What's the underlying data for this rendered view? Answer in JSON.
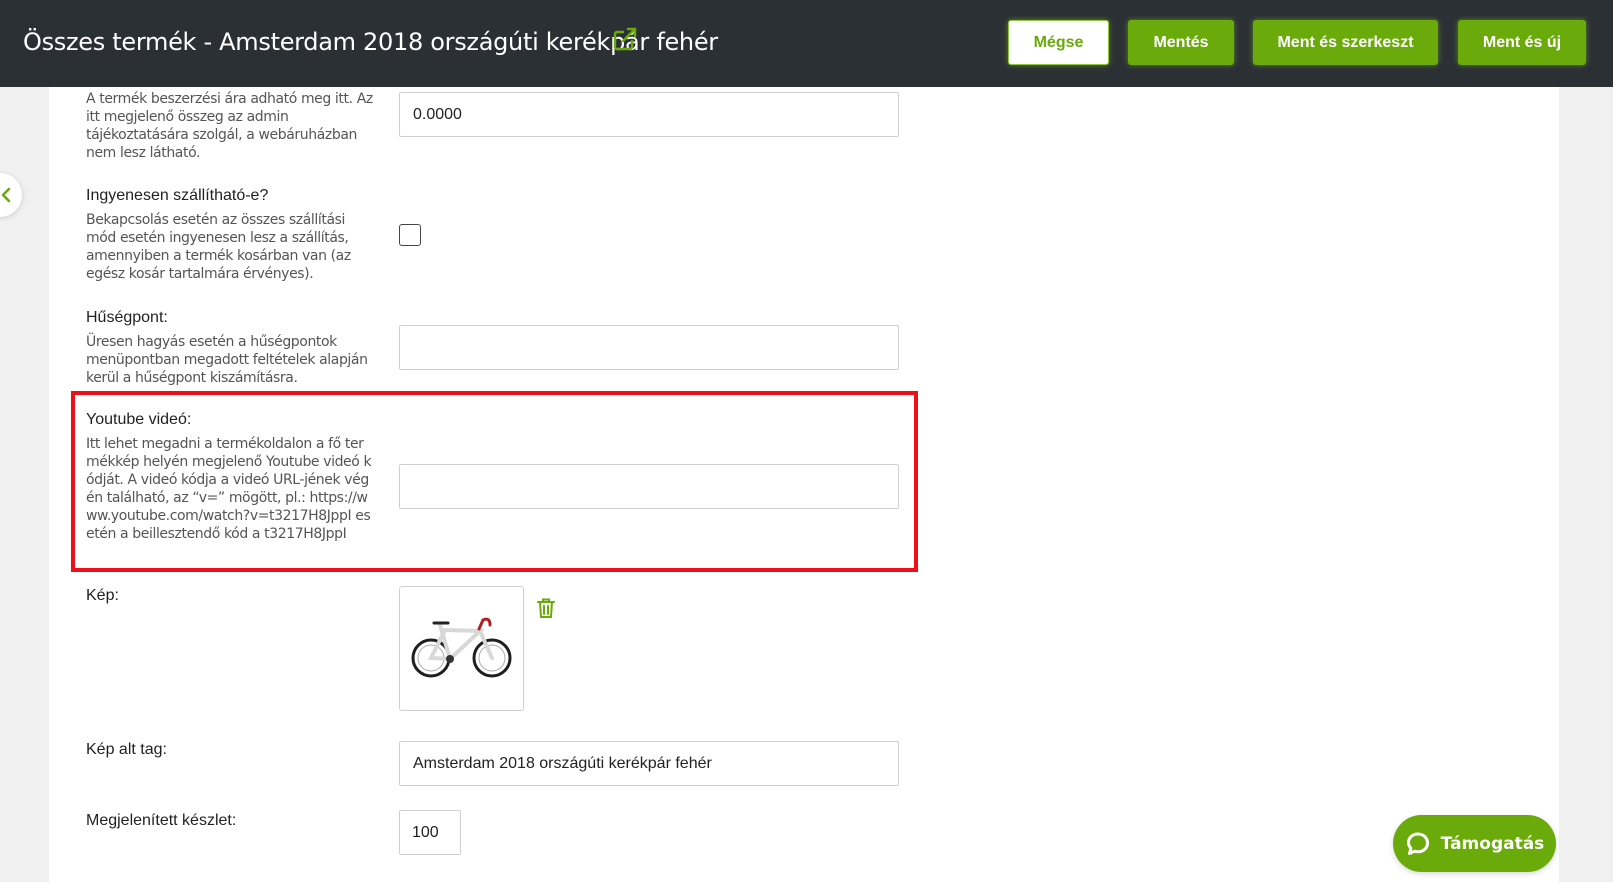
{
  "header": {
    "title": "Összes termék - Amsterdam 2018 országúti kerékpár fehér",
    "external_link_icon": "external-link-icon",
    "buttons": {
      "cancel": "Mégse",
      "save": "Mentés",
      "save_edit": "Ment és szerkeszt",
      "save_new": "Ment és új"
    }
  },
  "colors": {
    "accent": "#6aaa0b",
    "header_bg": "#2b3035",
    "highlight": "#f00f17"
  },
  "form": {
    "purchase_price": {
      "description": "A termék beszerzési ára adható meg itt. Az itt megjelenő összeg az admin tájékoztatására szolgál, a webáruházban nem lesz látható.",
      "value": "0.0000"
    },
    "free_shipping": {
      "label": "Ingyenesen szállítható-e?",
      "description": "Bekapcsolás esetén az összes szállítási mód esetén ingyenesen lesz a szállítás, amennyiben a termék kosárban van (az egész kosár tartalmára érvényes).",
      "checked": false
    },
    "loyalty_points": {
      "label": "Hűségpont:",
      "description": "Üresen hagyás esetén a hűségpontok menüpontban megadott feltételek alapján kerül a hűségpont kiszámításra.",
      "value": ""
    },
    "youtube_video": {
      "label": "Youtube videó:",
      "description": "Itt lehet megadni a termékoldalon a fő termékkép helyén megjelenő Youtube videó kódját. A videó kódja a videó URL-jének végén található, az “v=” mögött, pl.: https://www.youtube.com/watch?v=t3217H8JppI esetén a beillesztendő kód a t3217H8JppI",
      "value": ""
    },
    "image": {
      "label": "Kép:",
      "delete_icon": "trash-icon"
    },
    "image_alt": {
      "label": "Kép alt tag:",
      "value": "Amsterdam 2018 országúti kerékpár fehér"
    },
    "displayed_stock": {
      "label": "Megjelenített készlet:",
      "value": "100"
    }
  },
  "support": {
    "label": "Támogatás",
    "icon": "chat-bubble-icon"
  }
}
